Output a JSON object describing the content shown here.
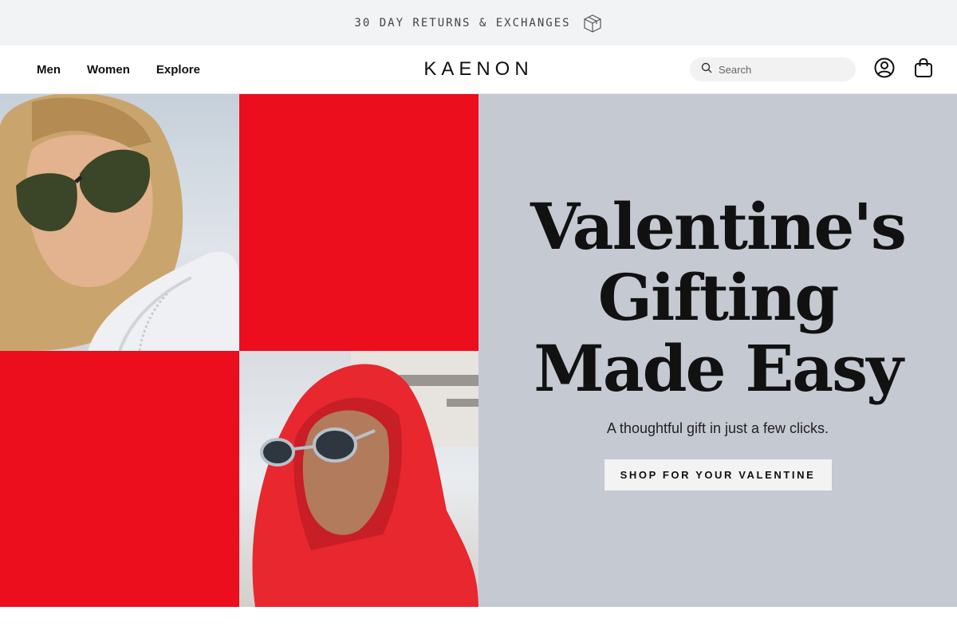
{
  "announcement": {
    "text": "30 DAY RETURNS & EXCHANGES",
    "icon": "package-box-icon"
  },
  "header": {
    "nav": [
      {
        "label": "Men"
      },
      {
        "label": "Women"
      },
      {
        "label": "Explore"
      }
    ],
    "logo": "KAENON",
    "search": {
      "placeholder": "Search",
      "value": "",
      "icon": "search-icon"
    },
    "account_icon": "user-circle-icon",
    "bag_icon": "shopping-bag-icon"
  },
  "hero": {
    "headline": "Valentine's Gifting Made Easy",
    "subheadline": "A thoughtful gift in just a few clicks.",
    "cta_label": "SHOP FOR YOUR VALENTINE",
    "colors": {
      "red": "#ec0d1d",
      "panel": "#c5c9d2"
    },
    "images": [
      {
        "name": "woman-in-sunglasses-photo"
      },
      {
        "name": "man-in-red-hoodie-photo"
      }
    ]
  }
}
